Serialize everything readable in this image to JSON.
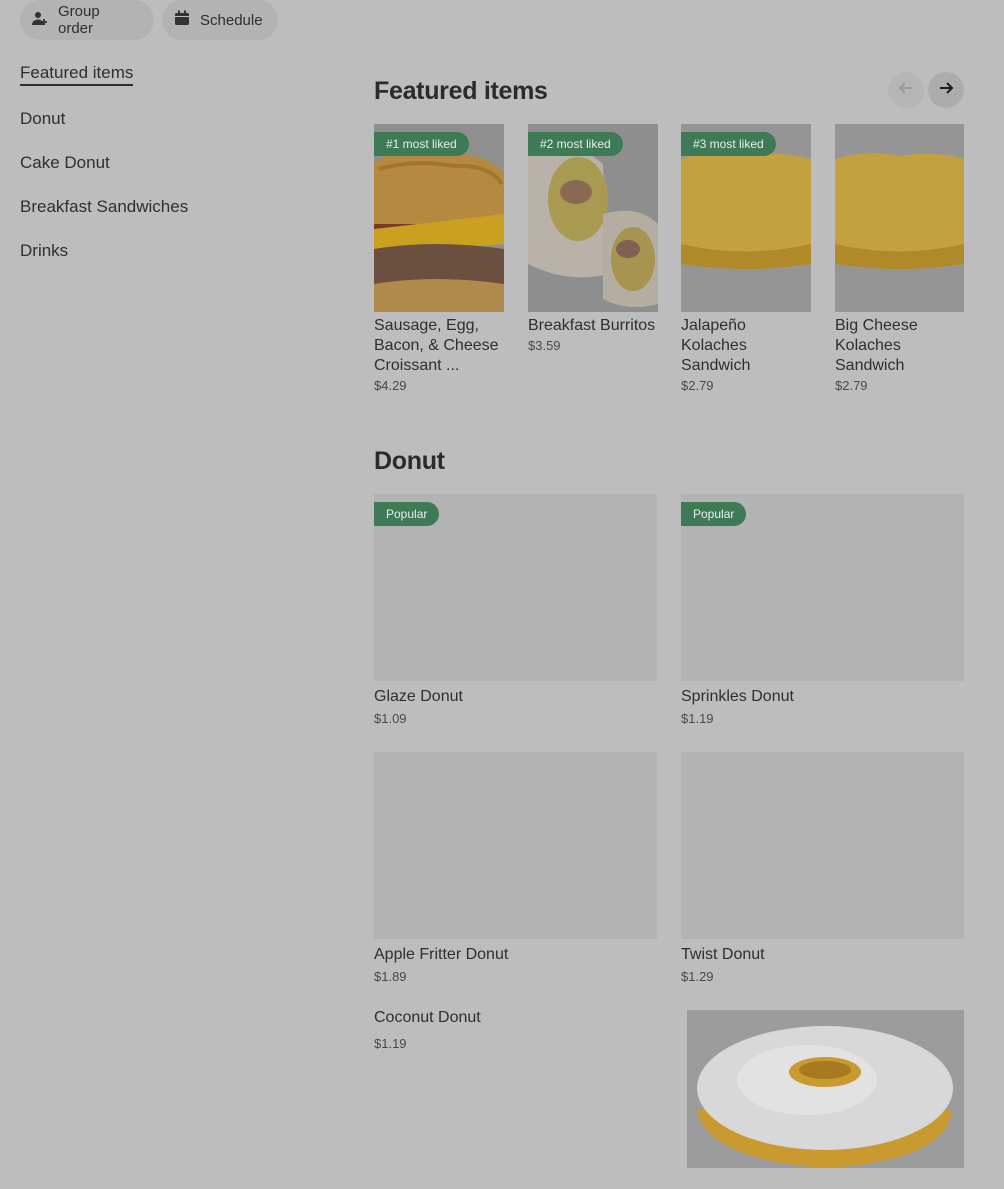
{
  "toolbar": {
    "group_order": "Group order",
    "schedule": "Schedule"
  },
  "sidebar": {
    "items": [
      {
        "label": "Featured items"
      },
      {
        "label": "Donut"
      },
      {
        "label": "Cake Donut"
      },
      {
        "label": "Breakfast Sandwiches"
      },
      {
        "label": "Drinks"
      }
    ]
  },
  "featured": {
    "title": "Featured items",
    "items": [
      {
        "badge": "#1 most liked",
        "name": "Sausage, Egg, Bacon, & Cheese Croissant ...",
        "price": "$4.29"
      },
      {
        "badge": "#2 most liked",
        "name": "Breakfast Burritos",
        "price": "$3.59"
      },
      {
        "badge": "#3 most liked",
        "name": "Jalapeño Kolaches Sandwich",
        "price": "$2.79"
      },
      {
        "badge": "",
        "name": "Big Cheese Kolaches Sandwich",
        "price": "$2.79"
      }
    ]
  },
  "donut": {
    "title": "Donut",
    "items": [
      {
        "badge": "Popular",
        "name": "Glaze Donut",
        "price": "$1.09"
      },
      {
        "badge": "Popular",
        "name": "Sprinkles Donut",
        "price": "$1.19"
      },
      {
        "badge": "",
        "name": "Apple Fritter Donut",
        "price": "$1.89"
      },
      {
        "badge": "",
        "name": "Twist Donut",
        "price": "$1.29"
      },
      {
        "badge": "",
        "name": "Coconut Donut",
        "price": "$1.19"
      }
    ]
  },
  "colors": {
    "badge_green": "#3f7a56",
    "overlay_gray": "#bdbdbd"
  }
}
